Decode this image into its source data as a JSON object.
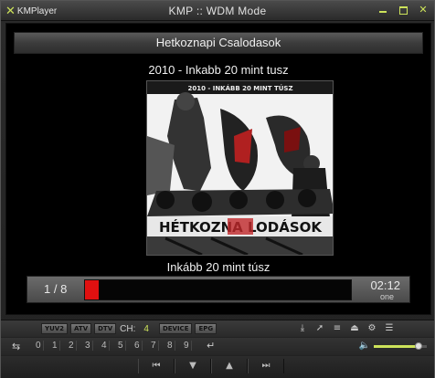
{
  "window": {
    "app_name": "KMPlayer",
    "title": "KMP :: WDM Mode"
  },
  "display": {
    "album_title": "Hetkoznapi Csalodasok",
    "track_title": "2010 - Inkabb 20 mint tusz",
    "caption": "Inkább 20 mint túsz",
    "cover_logo_text": "HÉTKOZNA LODÁSOK",
    "cover_top_text": "2010 - INKÁBB 20 MINT TÚSZ"
  },
  "progress": {
    "position": "1 / 8",
    "time": "02:12",
    "mode": "one",
    "fill_fraction": 0.05,
    "fill_color": "#e01010"
  },
  "tv_controls": {
    "buttons": [
      "YUV2",
      "ATV",
      "DTV"
    ],
    "ch_label": "CH:",
    "ch_value": "4",
    "buttons2": [
      "DEVICE",
      "EPG"
    ]
  },
  "toolbar_icons": [
    "download-icon",
    "cursor-icon",
    "list-icon",
    "eject-icon",
    "gear-icon",
    "menu-icon"
  ],
  "digits": [
    "0",
    "1",
    "2",
    "3",
    "4",
    "5",
    "6",
    "7",
    "8",
    "9"
  ],
  "volume": {
    "level": 0.85,
    "accent": "#cde35a"
  },
  "nav_icons": [
    "skip-back-icon",
    "down-icon",
    "up-icon",
    "skip-forward-icon"
  ]
}
